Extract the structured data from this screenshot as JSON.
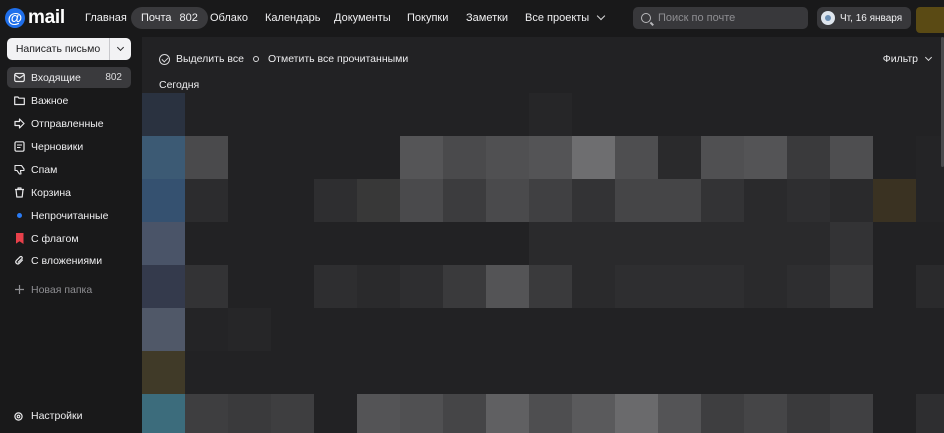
{
  "header": {
    "logo_at": "@",
    "logo_text": "mail",
    "nav": [
      {
        "label": "Главная"
      },
      {
        "label": "Почта",
        "count": "802",
        "active": true
      },
      {
        "label": "Облако"
      },
      {
        "label": "Календарь"
      },
      {
        "label": "Документы"
      },
      {
        "label": "Покупки"
      },
      {
        "label": "Заметки"
      },
      {
        "label": "Все проекты",
        "icon": "chevron-down-icon"
      }
    ],
    "search": {
      "placeholder": "Поиск по почте",
      "value": "",
      "icon": "search-icon"
    },
    "date": {
      "label": "Чт, 16 января",
      "icon": "weather-icon"
    },
    "avatar": {
      "color": "#5a4a14"
    }
  },
  "sidebar": {
    "compose_label": "Написать письмо",
    "folders": [
      {
        "label": "Входящие",
        "count": "802",
        "icon": "inbox-icon",
        "active": true
      },
      {
        "label": "Важное",
        "icon": "folder-icon"
      },
      {
        "label": "Отправленные",
        "icon": "send-icon"
      },
      {
        "label": "Черновики",
        "icon": "draft-icon"
      },
      {
        "label": "Спам",
        "icon": "dislike-icon"
      },
      {
        "label": "Корзина",
        "icon": "trash-icon"
      },
      {
        "label": "Непрочитанные",
        "icon": "unread-dot-icon"
      },
      {
        "label": "С флагом",
        "icon": "flag-icon"
      },
      {
        "label": "С вложениями",
        "icon": "paperclip-icon"
      }
    ],
    "new_folder_label": "Новая папка",
    "settings_label": "Настройки"
  },
  "main": {
    "select_all_label": "Выделить все",
    "mark_all_read_label": "Отметить все прочитанными",
    "filter_label": "Фильтр",
    "section_today": "Сегодня"
  },
  "colors": {
    "accent": "#1f6feb",
    "background": "#19191a",
    "panel": "#222224",
    "pill": "#3a3a3d",
    "unread_dot": "#2a7bf4",
    "flag": "#e8404a"
  }
}
